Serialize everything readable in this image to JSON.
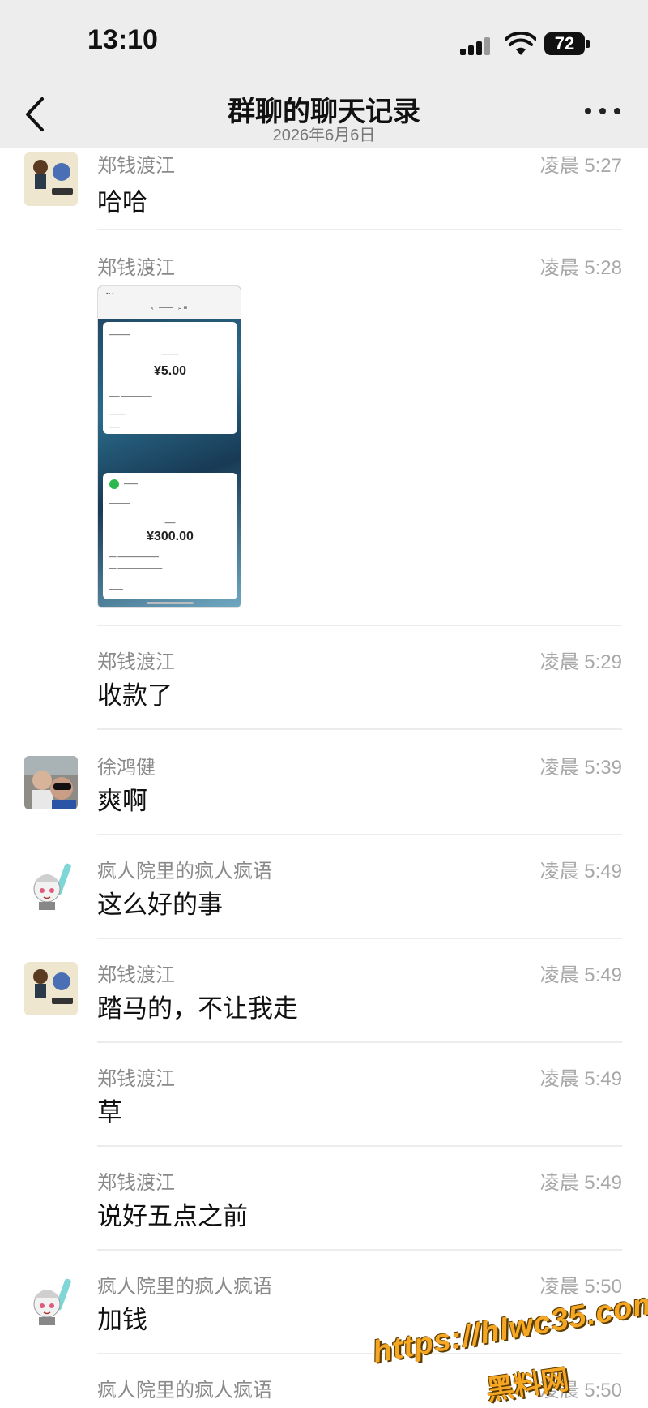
{
  "status_bar": {
    "time": "13:10",
    "battery": "72"
  },
  "nav": {
    "title": "群聊的聊天记录",
    "subtitle": "2026年6月6日"
  },
  "messages": [
    {
      "sender": "郑钱渡江",
      "time": "凌晨 5:27",
      "text": "哈哈"
    },
    {
      "sender": "郑钱渡江",
      "time": "凌晨 5:28"
    },
    {
      "sender": "郑钱渡江",
      "time": "凌晨 5:29",
      "text": "收款了"
    },
    {
      "sender": "徐鸿健",
      "time": "凌晨 5:39",
      "text": "爽啊"
    },
    {
      "sender": "疯人院里的疯人疯语",
      "time": "凌晨 5:49",
      "text": "这么好的事"
    },
    {
      "sender": "郑钱渡江",
      "time": "凌晨 5:49",
      "text": "踏马的，不让我走"
    },
    {
      "sender": "郑钱渡江",
      "time": "凌晨 5:49",
      "text": "草"
    },
    {
      "sender": "郑钱渡江",
      "time": "凌晨 5:49",
      "text": "说好五点之前"
    },
    {
      "sender": "疯人院里的疯人疯语",
      "time": "凌晨 5:50",
      "text": "加钱"
    },
    {
      "sender": "疯人院里的疯人疯语",
      "time": "凌晨 5:50"
    }
  ],
  "screenshot_card": {
    "amount_1": "¥5.00",
    "amount_2": "¥300.00"
  },
  "watermark": {
    "url": "https://hlwc35.com",
    "site": "黑料网"
  },
  "colors": {
    "accent": "#2db84d",
    "watermark": "#f5a623"
  }
}
